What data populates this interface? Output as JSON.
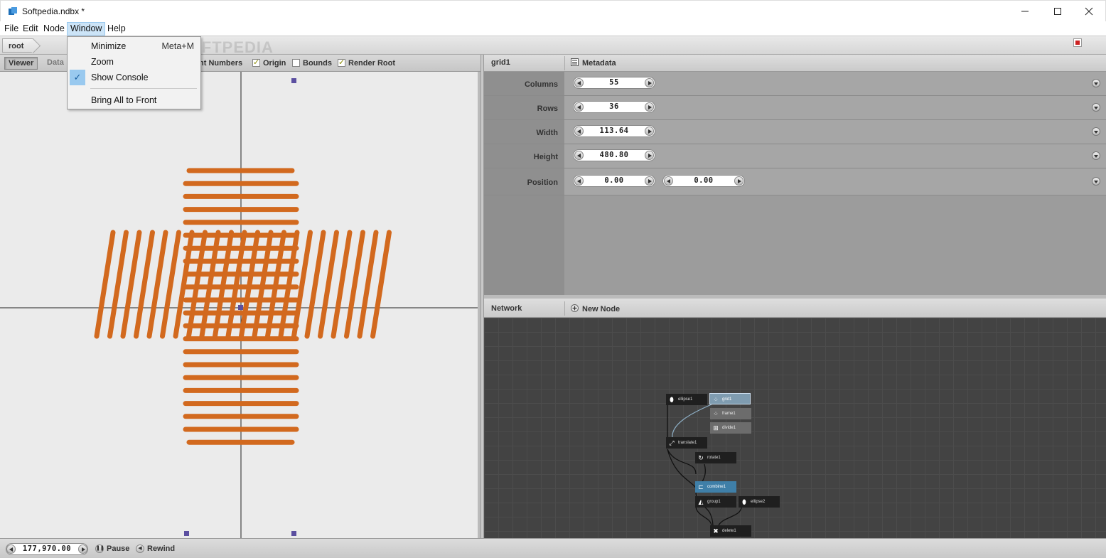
{
  "window": {
    "title": "Softpedia.ndbx *"
  },
  "menubar": {
    "items": [
      "File",
      "Edit",
      "Node",
      "Window",
      "Help"
    ]
  },
  "window_menu": {
    "items": [
      {
        "label": "Minimize",
        "shortcut": "Meta+M",
        "checked": false
      },
      {
        "label": "Zoom",
        "shortcut": "",
        "checked": false
      },
      {
        "label": "Show Console",
        "shortcut": "",
        "checked": true
      },
      {
        "label": "Bring All to Front",
        "shortcut": "",
        "checked": false
      }
    ]
  },
  "pathbar": {
    "crumb": "root",
    "watermark": "SOFTPEDIA"
  },
  "viewer": {
    "tabs": {
      "viewer": "Viewer",
      "data": "Data"
    },
    "options": [
      {
        "label": "nt Numbers",
        "checked": false
      },
      {
        "label": "Origin",
        "checked": true
      },
      {
        "label": "Bounds",
        "checked": false
      },
      {
        "label": "Render Root",
        "checked": true
      }
    ],
    "stroke_color": "#d2691e"
  },
  "params": {
    "node": "grid1",
    "metadata_label": "Metadata",
    "rows": [
      {
        "label": "Columns",
        "values": [
          "55"
        ]
      },
      {
        "label": "Rows",
        "values": [
          "36"
        ]
      },
      {
        "label": "Width",
        "values": [
          "113.64"
        ]
      },
      {
        "label": "Height",
        "values": [
          "480.80"
        ]
      },
      {
        "label": "Position",
        "values": [
          "0.00",
          "0.00"
        ]
      }
    ]
  },
  "network": {
    "title": "Network",
    "new_node": "New Node",
    "nodes": [
      {
        "name": "ellipse1",
        "icon": "ellipse-icon",
        "style": "normal"
      },
      {
        "name": "grid1",
        "icon": "grid-icon",
        "style": "selected"
      },
      {
        "name": "frame1",
        "icon": "grid-icon",
        "style": "gray"
      },
      {
        "name": "divide1",
        "icon": "divide-icon",
        "style": "gray"
      },
      {
        "name": "translate1",
        "icon": "translate-icon",
        "style": "normal"
      },
      {
        "name": "rotate1",
        "icon": "rotate-icon",
        "style": "normal"
      },
      {
        "name": "combine1",
        "icon": "combine-icon",
        "style": "render"
      },
      {
        "name": "group1",
        "icon": "group-icon",
        "style": "normal"
      },
      {
        "name": "ellipse2",
        "icon": "ellipse-icon",
        "style": "normal"
      },
      {
        "name": "delete1",
        "icon": "delete-icon",
        "style": "normal"
      }
    ]
  },
  "statusbar": {
    "frame": "177,970.00",
    "pause": "Pause",
    "rewind": "Rewind"
  }
}
